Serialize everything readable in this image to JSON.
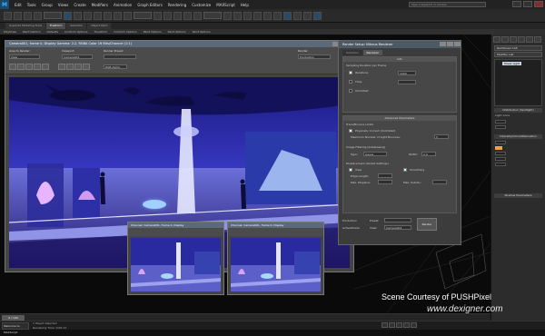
{
  "app": {
    "title": "",
    "search_placeholder": "Type a keyword or phrase",
    "menus": [
      "Edit",
      "Tools",
      "Group",
      "Views",
      "Create",
      "Modifiers",
      "Animation",
      "Graph Editors",
      "Rendering",
      "Customize",
      "MAXScript",
      "Help"
    ]
  },
  "ribbon": {
    "tabs": [
      "Graphite Modeling Tools",
      "Freeform",
      "Selection",
      "Object Paint"
    ],
    "active_tab": 1,
    "sub_items": [
      "PolyDraw",
      "Paint Deform",
      "Defaults",
      "Conform Options",
      "Transform",
      "Conform Options",
      "Paint Options",
      "Paint Options",
      "Paint Options"
    ]
  },
  "render_frame": {
    "title": "Camera001, frame 0, Display Gamma: 2.2, RGBA Color 16 Bits/Channel (1:1)",
    "area_label": "Area to Render:",
    "area_value": "View",
    "viewport_label": "Viewport:",
    "viewport_value": "Camera001",
    "preset_label": "Render Preset:",
    "render_btn": "Render",
    "production_value": "Production",
    "channel_value": "RGB Alpha"
  },
  "render_dialog": {
    "title": "Render Setup: Nitrous Renderer",
    "tabs": [
      "Common",
      "Renderer"
    ],
    "common_rollout": "Info",
    "sampling_rollout": "Sampling Duration per Frame",
    "iterations_label": "Iterations",
    "iterations_value": "1000",
    "time_label": "Time",
    "unlimited_label": "Unlimited",
    "adv_rollout": "Advanced Parameters",
    "trace_label": "Trace/Bounce Limits",
    "phys_label": "Physically Correct (Unlimited)",
    "max_bounces_label": "Maximum Number of Light Bounces:",
    "max_bounces_value": "5",
    "filter_label": "Image Filtering (Antialiasing)",
    "type_label": "Type:",
    "type_value": "Gauss",
    "width_label": "Width:",
    "width_value": "2.0",
    "displacement_label": "Displacement (Global Settings)",
    "view_label": "View",
    "smoothing_label": "Smoothing",
    "edge_length_label": "Edge Length:",
    "max_displace_label": "Max. Displace:",
    "max_subdiv_label": "Max. Subdiv.:",
    "preset_label": "Preset:",
    "view_sel_label": "View:",
    "view_sel_value": "Camera001",
    "render_btn": "Render",
    "activeshade_label": "ActiveShade"
  },
  "mini_windows": [
    {
      "title": "Channel: Camera001, frame 0, Display"
    },
    {
      "title": "Channel: Camera001, frame 0, Display"
    }
  ],
  "command_panel": {
    "field": "Rectilinear 145",
    "modifier_list": "Modifier List",
    "list_item": "Tower Light",
    "distribution_hdr": "Distribution (Spotlight)",
    "light_cone_label": "Light Cone",
    "intensity_hdr": "Intensity/Color/Attenuation",
    "shadows_hdr": "Shadow Parameters"
  },
  "status": {
    "selected": "1 Object Selected",
    "frame_text": "Rendering Time: 0:00:12",
    "time_slider": "0 / 100",
    "mode": "Welcome to MAXScript"
  },
  "credit": "Scene Courtesy of PUSHPixel",
  "watermark": "www.dexigner.com",
  "colors": {
    "accent": "#2a4a6a",
    "scene_bg": "#1a1660",
    "light_orange": "#f2a23a"
  }
}
